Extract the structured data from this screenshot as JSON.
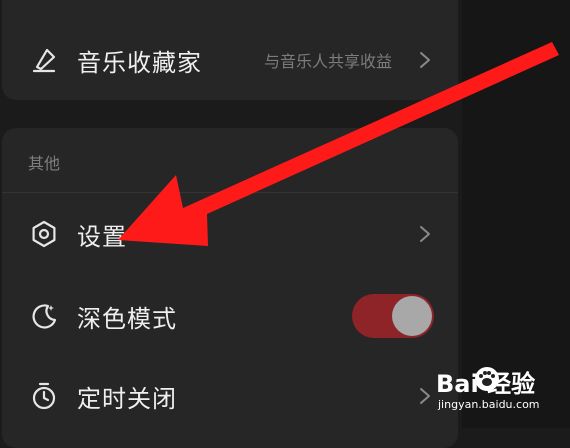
{
  "top_card": {
    "music_collector": {
      "label": "音乐收藏家",
      "subtitle": "与音乐人共享收益",
      "icon": "quill-pen-icon"
    }
  },
  "other_section": {
    "title": "其他",
    "items": [
      {
        "label": "设置",
        "icon": "hexagon-settings-icon",
        "control": "chevron"
      },
      {
        "label": "深色模式",
        "icon": "moon-stars-icon",
        "control": "toggle",
        "enabled": true
      },
      {
        "label": "定时关闭",
        "icon": "stopwatch-icon",
        "control": "chevron"
      }
    ]
  },
  "colors": {
    "toggle_on": "#8e2328",
    "annotation_arrow": "#ff1a1a"
  },
  "watermark": {
    "brand": "Bai 经验",
    "site": "jingyan.baidu.com"
  }
}
